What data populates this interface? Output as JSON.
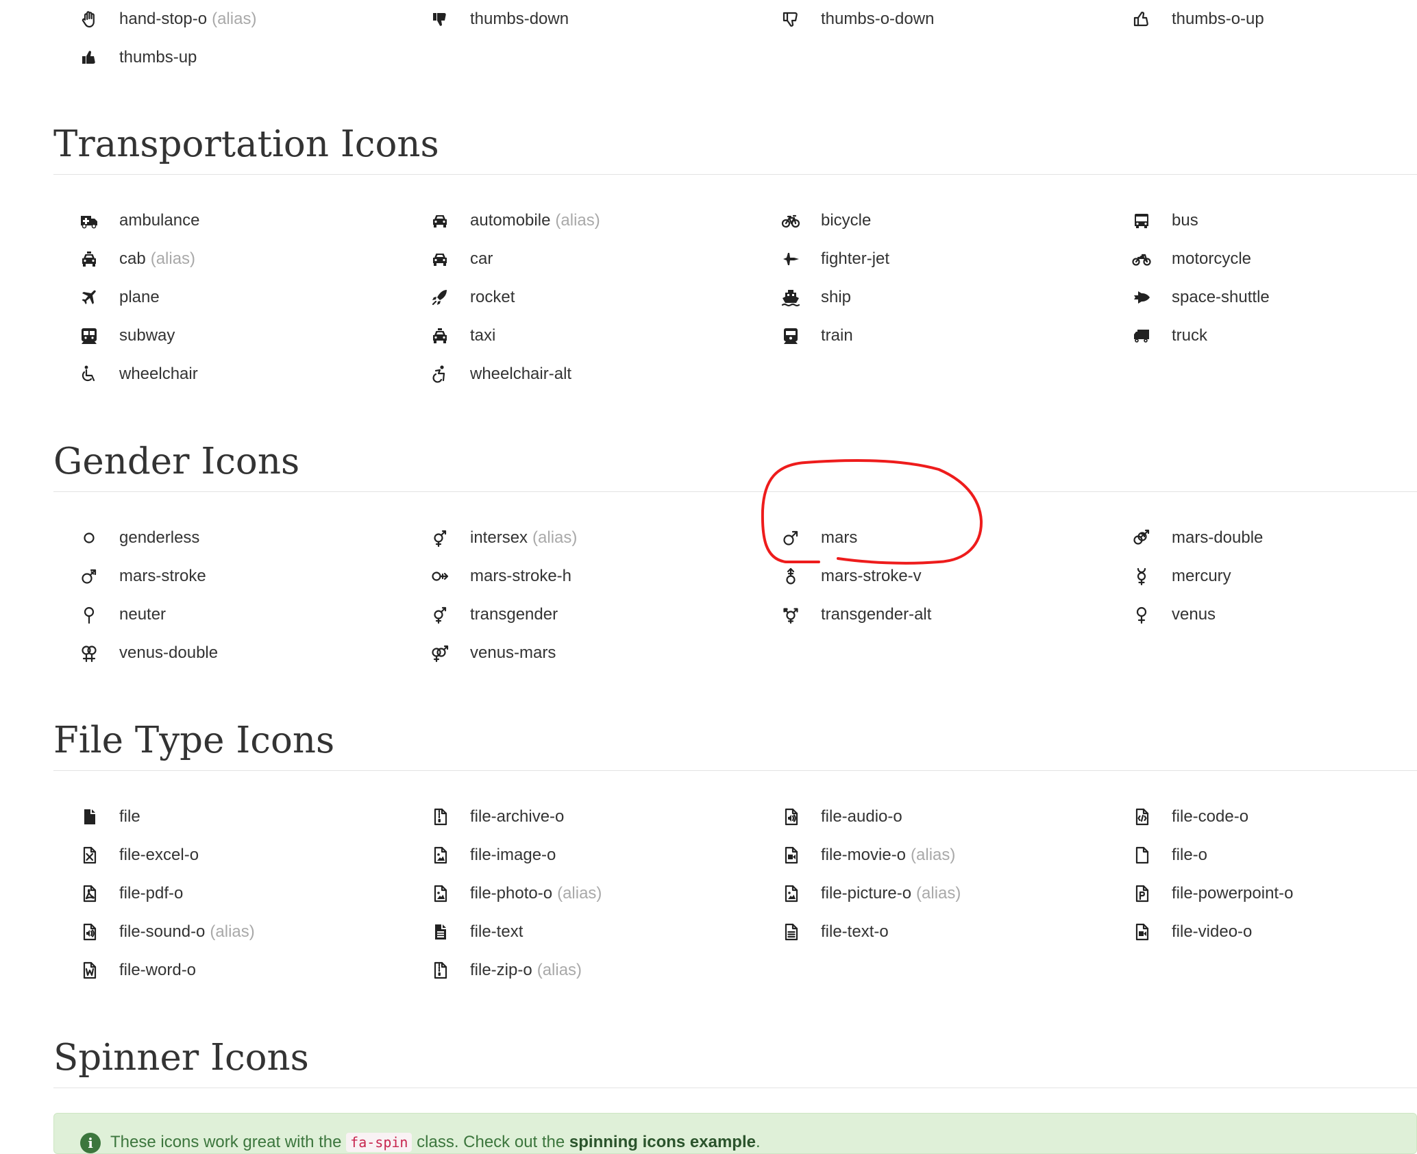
{
  "alias_label": "(alias)",
  "hand_section": {
    "items": [
      {
        "name": "hand-stop-o",
        "alias": true,
        "icon": "hand-stop-o-icon"
      },
      {
        "name": "thumbs-down",
        "alias": false,
        "icon": "thumbs-down-icon"
      },
      {
        "name": "thumbs-o-down",
        "alias": false,
        "icon": "thumbs-o-down-icon"
      },
      {
        "name": "thumbs-o-up",
        "alias": false,
        "icon": "thumbs-o-up-icon"
      },
      {
        "name": "thumbs-up",
        "alias": false,
        "icon": "thumbs-up-icon"
      }
    ]
  },
  "transportation": {
    "title": "Transportation Icons",
    "items": [
      {
        "name": "ambulance",
        "alias": false,
        "icon": "ambulance-icon"
      },
      {
        "name": "automobile",
        "alias": true,
        "icon": "car-icon"
      },
      {
        "name": "bicycle",
        "alias": false,
        "icon": "bicycle-icon"
      },
      {
        "name": "bus",
        "alias": false,
        "icon": "bus-icon"
      },
      {
        "name": "cab",
        "alias": true,
        "icon": "taxi-icon"
      },
      {
        "name": "car",
        "alias": false,
        "icon": "car-icon"
      },
      {
        "name": "fighter-jet",
        "alias": false,
        "icon": "fighter-jet-icon"
      },
      {
        "name": "motorcycle",
        "alias": false,
        "icon": "motorcycle-icon"
      },
      {
        "name": "plane",
        "alias": false,
        "icon": "plane-icon"
      },
      {
        "name": "rocket",
        "alias": false,
        "icon": "rocket-icon"
      },
      {
        "name": "ship",
        "alias": false,
        "icon": "ship-icon"
      },
      {
        "name": "space-shuttle",
        "alias": false,
        "icon": "space-shuttle-icon"
      },
      {
        "name": "subway",
        "alias": false,
        "icon": "subway-icon"
      },
      {
        "name": "taxi",
        "alias": false,
        "icon": "taxi-icon"
      },
      {
        "name": "train",
        "alias": false,
        "icon": "train-icon"
      },
      {
        "name": "truck",
        "alias": false,
        "icon": "truck-icon"
      },
      {
        "name": "wheelchair",
        "alias": false,
        "icon": "wheelchair-icon"
      },
      {
        "name": "wheelchair-alt",
        "alias": false,
        "icon": "wheelchair-alt-icon"
      }
    ]
  },
  "gender": {
    "title": "Gender Icons",
    "items": [
      {
        "name": "genderless",
        "alias": false,
        "icon": "genderless-icon"
      },
      {
        "name": "intersex",
        "alias": true,
        "icon": "transgender-icon"
      },
      {
        "name": "mars",
        "alias": false,
        "icon": "mars-icon"
      },
      {
        "name": "mars-double",
        "alias": false,
        "icon": "mars-double-icon"
      },
      {
        "name": "mars-stroke",
        "alias": false,
        "icon": "mars-stroke-icon"
      },
      {
        "name": "mars-stroke-h",
        "alias": false,
        "icon": "mars-stroke-h-icon"
      },
      {
        "name": "mars-stroke-v",
        "alias": false,
        "icon": "mars-stroke-v-icon"
      },
      {
        "name": "mercury",
        "alias": false,
        "icon": "mercury-icon"
      },
      {
        "name": "neuter",
        "alias": false,
        "icon": "neuter-icon"
      },
      {
        "name": "transgender",
        "alias": false,
        "icon": "transgender-icon"
      },
      {
        "name": "transgender-alt",
        "alias": false,
        "icon": "transgender-alt-icon"
      },
      {
        "name": "venus",
        "alias": false,
        "icon": "venus-icon"
      },
      {
        "name": "venus-double",
        "alias": false,
        "icon": "venus-double-icon"
      },
      {
        "name": "venus-mars",
        "alias": false,
        "icon": "venus-mars-icon"
      }
    ]
  },
  "file_type": {
    "title": "File Type Icons",
    "items": [
      {
        "name": "file",
        "alias": false,
        "icon": "file-icon"
      },
      {
        "name": "file-archive-o",
        "alias": false,
        "icon": "file-archive-o-icon"
      },
      {
        "name": "file-audio-o",
        "alias": false,
        "icon": "file-audio-o-icon"
      },
      {
        "name": "file-code-o",
        "alias": false,
        "icon": "file-code-o-icon"
      },
      {
        "name": "file-excel-o",
        "alias": false,
        "icon": "file-excel-o-icon"
      },
      {
        "name": "file-image-o",
        "alias": false,
        "icon": "file-image-o-icon"
      },
      {
        "name": "file-movie-o",
        "alias": true,
        "icon": "file-video-o-icon"
      },
      {
        "name": "file-o",
        "alias": false,
        "icon": "file-o-icon"
      },
      {
        "name": "file-pdf-o",
        "alias": false,
        "icon": "file-pdf-o-icon"
      },
      {
        "name": "file-photo-o",
        "alias": true,
        "icon": "file-image-o-icon"
      },
      {
        "name": "file-picture-o",
        "alias": true,
        "icon": "file-image-o-icon"
      },
      {
        "name": "file-powerpoint-o",
        "alias": false,
        "icon": "file-powerpoint-o-icon"
      },
      {
        "name": "file-sound-o",
        "alias": true,
        "icon": "file-audio-o-icon"
      },
      {
        "name": "file-text",
        "alias": false,
        "icon": "file-text-icon"
      },
      {
        "name": "file-text-o",
        "alias": false,
        "icon": "file-text-o-icon"
      },
      {
        "name": "file-video-o",
        "alias": false,
        "icon": "file-video-o-icon"
      },
      {
        "name": "file-word-o",
        "alias": false,
        "icon": "file-word-o-icon"
      },
      {
        "name": "file-zip-o",
        "alias": true,
        "icon": "file-archive-o-icon"
      }
    ]
  },
  "spinner": {
    "title": "Spinner Icons",
    "alert": {
      "icon": "info-circle-icon",
      "text_before": "These icons work great with the",
      "code": "fa-spin",
      "text_middle": "class. Check out the",
      "link": "spinning icons example",
      "text_after": "."
    }
  },
  "annotation": {
    "color": "#ee1c1c",
    "target": "mars"
  }
}
